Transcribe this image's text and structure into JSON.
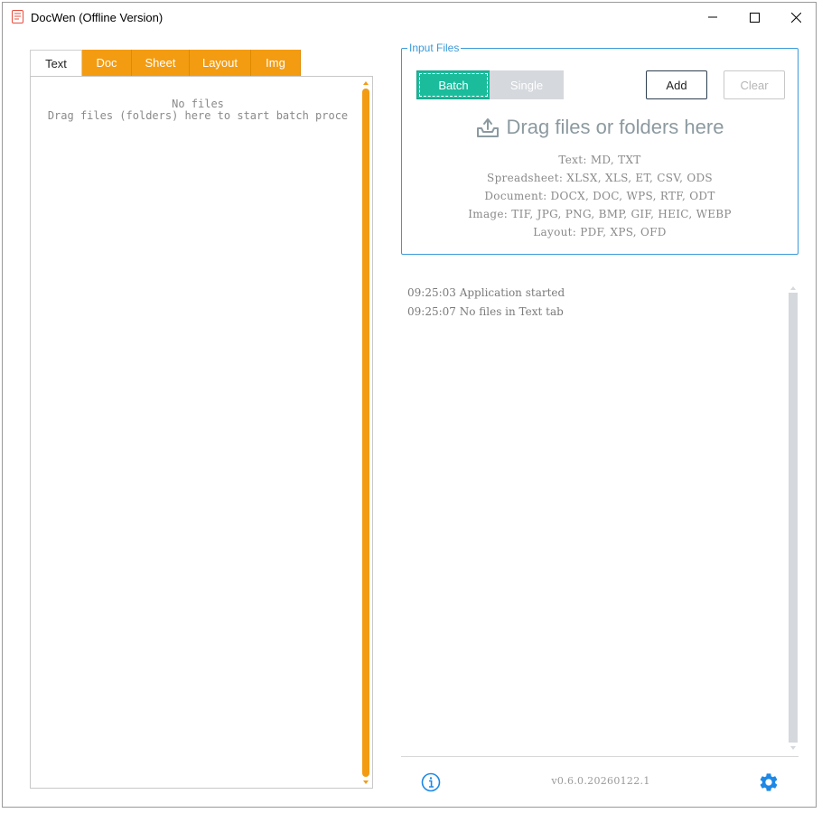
{
  "window": {
    "title": "DocWen (Offline Version)"
  },
  "tabs": [
    {
      "label": "Text",
      "active": true
    },
    {
      "label": "Doc",
      "active": false
    },
    {
      "label": "Sheet",
      "active": false
    },
    {
      "label": "Layout",
      "active": false
    },
    {
      "label": "Img",
      "active": false
    }
  ],
  "file_list": {
    "empty_title": "No files",
    "empty_hint": "Drag files (folders) here to start batch proce"
  },
  "input_files": {
    "legend": "Input Files",
    "batch_label": "Batch",
    "single_label": "Single",
    "add_label": "Add",
    "clear_label": "Clear",
    "drop_title": "Drag files or folders here",
    "formats": [
      "Text: MD, TXT",
      "Spreadsheet: XLSX, XLS, ET, CSV, ODS",
      "Document: DOCX, DOC, WPS, RTF, ODT",
      "Image: TIF, JPG, PNG, BMP, GIF, HEIC, WEBP",
      "Layout: PDF, XPS, OFD"
    ]
  },
  "log": [
    "09:25:03 Application started",
    "09:25:07 No files in Text tab"
  ],
  "footer": {
    "version": "v0.6.0.20260122.1"
  },
  "colors": {
    "accent_orange": "#f39c12",
    "batch_green": "#1abc9c",
    "group_blue": "#3a9ad9",
    "icon_blue": "#1e88e5"
  }
}
